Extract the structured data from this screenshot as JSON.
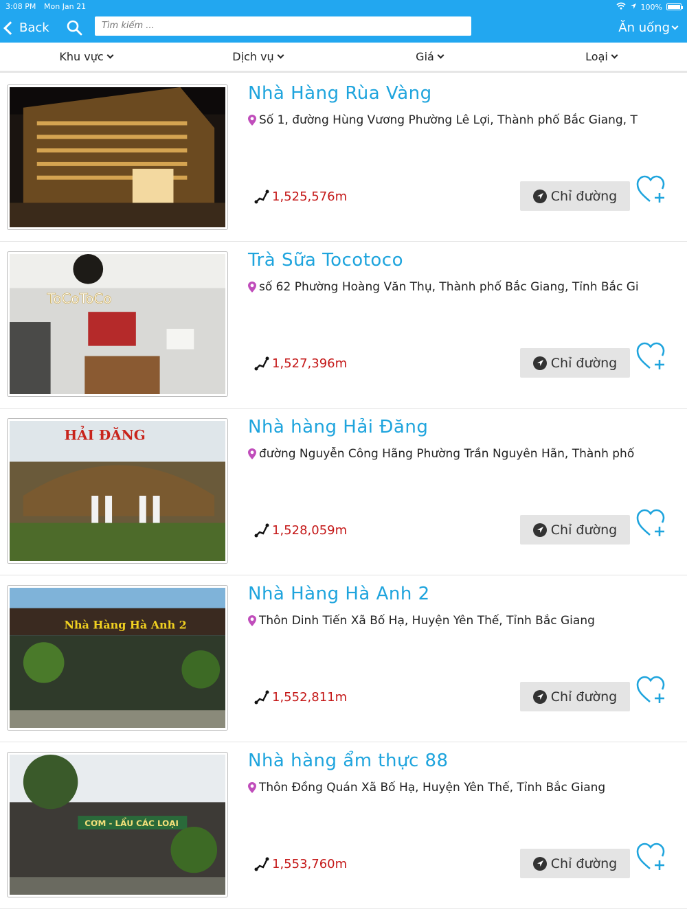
{
  "status_bar": {
    "time": "3:08 PM",
    "date": "Mon Jan 21",
    "battery": "100%"
  },
  "header": {
    "back_label": "Back",
    "search_placeholder": "Tìm kiếm ...",
    "category": "Ăn uống"
  },
  "filters": [
    {
      "label": "Khu vực"
    },
    {
      "label": "Dịch vụ"
    },
    {
      "label": "Giá"
    },
    {
      "label": "Loại"
    }
  ],
  "directions_label": "Chỉ đường",
  "places": [
    {
      "name": "Nhà Hàng Rùa Vàng",
      "address": "Số 1, đường Hùng Vương Phường Lê Lợi, Thành phố Bắc Giang, T",
      "distance": "1,525,576m"
    },
    {
      "name": "Trà Sữa Tocotoco",
      "address": "số 62 Phường Hoàng Văn Thụ, Thành phố Bắc Giang, Tỉnh Bắc Gi",
      "distance": "1,527,396m"
    },
    {
      "name": "Nhà hàng Hải Đăng",
      "address": "đường Nguyễn Công Hãng Phường Trần Nguyên Hãn, Thành phố",
      "distance": "1,528,059m"
    },
    {
      "name": "Nhà Hàng Hà Anh 2",
      "address": "Thôn Dinh Tiến Xã Bố Hạ, Huyện Yên Thế, Tỉnh Bắc Giang",
      "distance": "1,552,811m"
    },
    {
      "name": "Nhà hàng ẩm thực 88",
      "address": "Thôn Đồng Quán Xã Bố Hạ, Huyện Yên Thế, Tỉnh Bắc Giang",
      "distance": "1,553,760m"
    }
  ],
  "colors": {
    "header": "#22a7f0",
    "title": "#1ea4dd",
    "distance": "#c41717",
    "pin": "#c04dbb"
  }
}
